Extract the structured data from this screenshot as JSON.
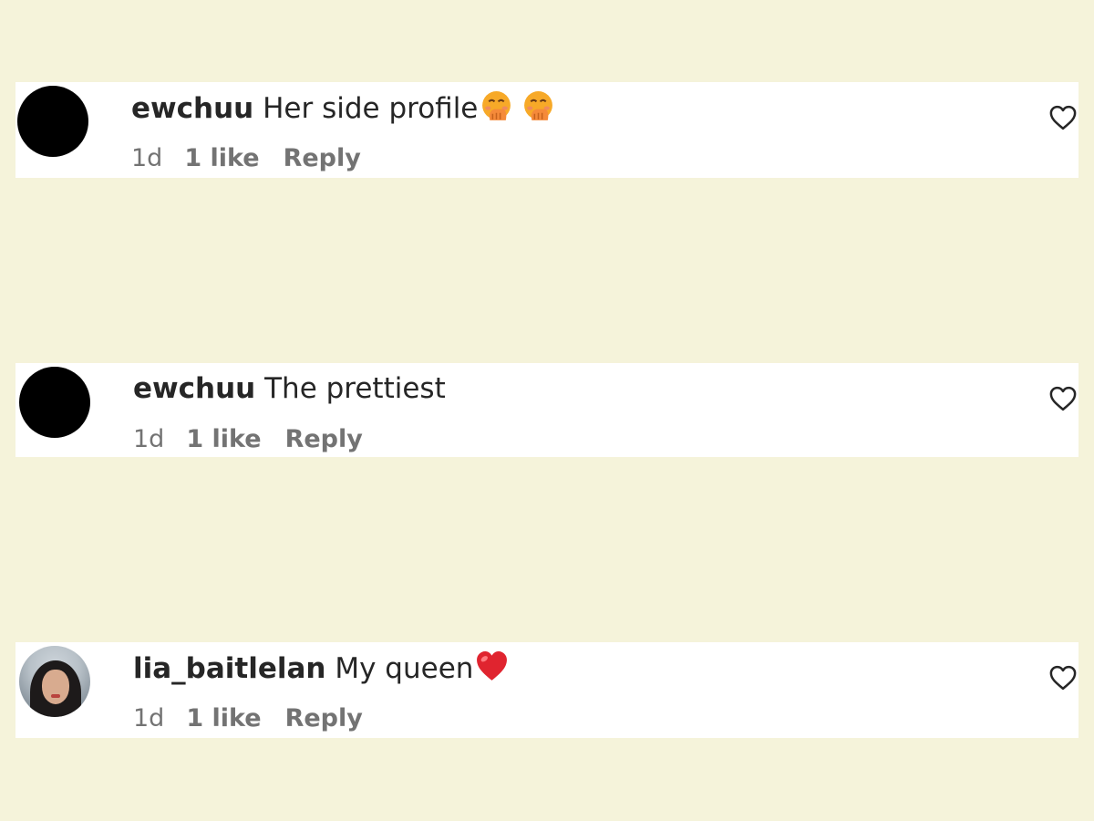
{
  "comments": [
    {
      "username": "ewchuu",
      "text": "Her side profile",
      "emojis": [
        "hand-over-mouth-emoji",
        "hand-over-mouth-emoji"
      ],
      "time": "1d",
      "likes": "1 like",
      "reply": "Reply",
      "avatar": "black-circle"
    },
    {
      "username": "ewchuu",
      "text": "The prettiest",
      "emojis": [],
      "time": "1d",
      "likes": "1 like",
      "reply": "Reply",
      "avatar": "black-circle"
    },
    {
      "username": "lia_baitlelan",
      "text": "My queen",
      "emojis": [
        "red-heart-emoji"
      ],
      "time": "1d",
      "likes": "1 like",
      "reply": "Reply",
      "avatar": "profile-photo"
    }
  ],
  "colors": {
    "background": "#f5f3da",
    "card": "#ffffff",
    "primary_text": "#262626",
    "secondary_text": "#737373",
    "emoji_heart": "#e0242f",
    "emoji_face": "#f7a928"
  },
  "icons": {
    "like": "heart-outline-icon"
  }
}
